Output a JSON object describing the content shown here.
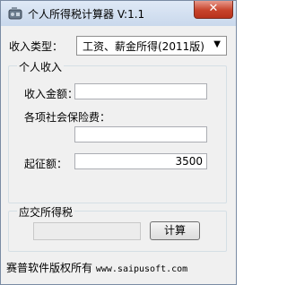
{
  "window": {
    "title": "个人所得税计算器 V:1.1",
    "close_label": "✕"
  },
  "form": {
    "income_type_label": "收入类型：",
    "income_type_value": "工资、薪金所得(2011版)",
    "personal_income_group": "个人收入",
    "income_amount_label": "收入金额：",
    "income_amount_value": "",
    "insurance_label": "各项社会保险费：",
    "insurance_value": "",
    "threshold_label": "起征额：",
    "threshold_value": "3500"
  },
  "result": {
    "group_title": "应交所得税",
    "value": "",
    "calc_button": "计算"
  },
  "footer": {
    "text": "赛普软件版权所有",
    "url": "www.saipusoft.com"
  },
  "icons": {
    "app": "calculator-icon",
    "combo_arrow": "chevron-down-icon"
  }
}
